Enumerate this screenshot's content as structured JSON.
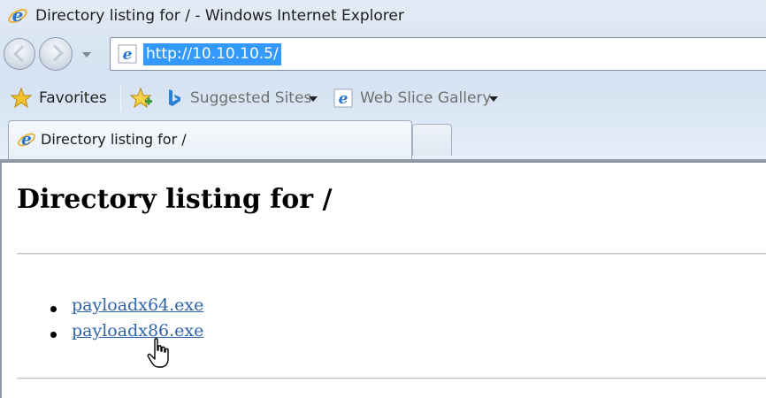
{
  "window": {
    "title": "Directory listing for / - Windows Internet Explorer"
  },
  "address_bar": {
    "url": "http://10.10.10.5/"
  },
  "favorites_bar": {
    "favorites_label": "Favorites",
    "suggested_sites_label": "Suggested Sites",
    "web_slice_gallery_label": "Web Slice Gallery"
  },
  "tabs": [
    {
      "label": "Directory listing for /"
    }
  ],
  "page": {
    "heading": "Directory listing for /",
    "files": [
      {
        "name": "payloadx64.exe"
      },
      {
        "name": "payloadx86.exe"
      }
    ]
  },
  "icons": {
    "browser": "ie-icon",
    "back": "back-arrow-icon",
    "forward": "forward-arrow-icon",
    "favorites": "favorites-star-icon",
    "add_favorites": "add-to-favorites-icon",
    "bing": "bing-icon",
    "cursor": "hand-pointer-icon"
  },
  "colors": {
    "link": "#2f64a8",
    "url_selection": "#3399ff"
  }
}
